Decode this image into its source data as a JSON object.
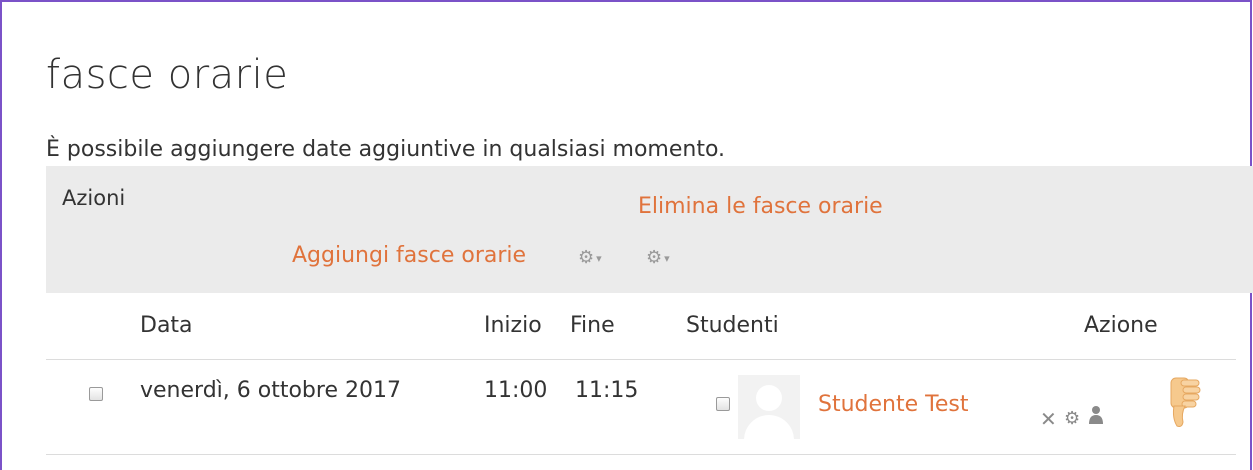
{
  "page": {
    "title": "fasce orarie",
    "note": "È possibile aggiungere date aggiuntive in qualsiasi momento."
  },
  "actions": {
    "title": "Azioni",
    "delete_link": "Elimina le fasce orarie",
    "add_link": "Aggiungi fasce orarie",
    "gear_icon": "⚙",
    "caret": "▾"
  },
  "table": {
    "headers": {
      "data": "Data",
      "inizio": "Inizio",
      "fine": "Fine",
      "studenti": "Studenti",
      "azione": "Azione"
    },
    "rows": [
      {
        "date": "venerdì, 6 ottobre 2017",
        "start": "11:00",
        "end": "11:15",
        "student": "Studente Test",
        "icons": {
          "delete": "✕",
          "edit": "⚙"
        }
      }
    ]
  },
  "colors": {
    "link": "#e0733c",
    "frame": "#7b52c8",
    "panel": "#ebebeb"
  }
}
